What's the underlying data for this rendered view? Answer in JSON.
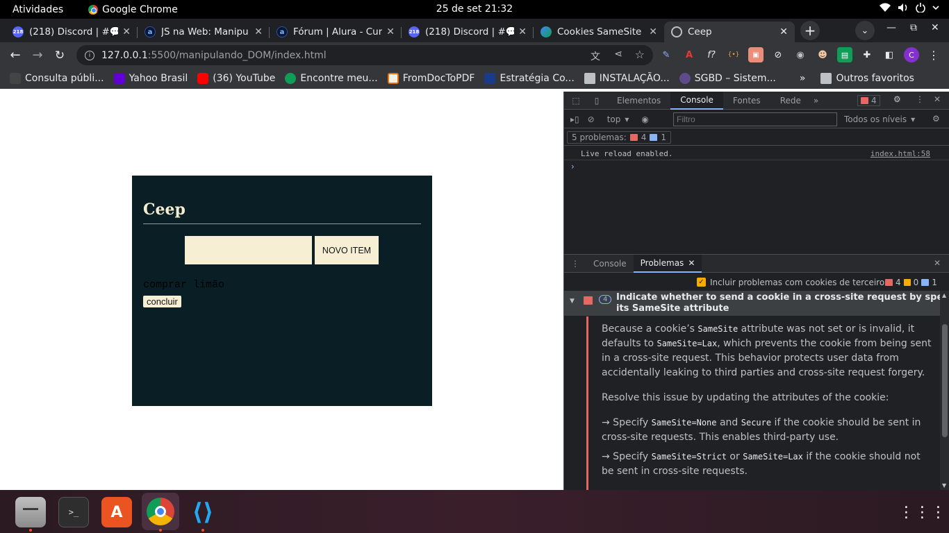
{
  "system": {
    "activities": "Atividades",
    "app_name": "Google Chrome",
    "clock": "25 de set  21:32"
  },
  "tabs": [
    {
      "title": "(218) Discord | #💬",
      "favicon": "discord-icon"
    },
    {
      "title": "JS na Web: Manipu",
      "favicon": "alura-icon"
    },
    {
      "title": "Fórum | Alura - Cur",
      "favicon": "alura-icon"
    },
    {
      "title": "(218) Discord | #💬",
      "favicon": "discord-icon"
    },
    {
      "title": "Cookies SameSite",
      "favicon": "cookie-icon"
    },
    {
      "title": "Ceep",
      "favicon": "globe-icon",
      "active": true
    }
  ],
  "discord_badge": "218",
  "address": {
    "host": "127.0.0.1",
    "path": ":5500/manipulando_DOM/index.html"
  },
  "bookmarks": [
    "Consulta públi...",
    "Yahoo Brasil",
    "(36) YouTube",
    "Encontre meu...",
    "FromDocToPDF",
    "Estratégia Co...",
    "INSTALAÇÃO...",
    "SGBD – Sistem...",
    "Outros favoritos"
  ],
  "profile_initial": "C",
  "ceep": {
    "title": "Ceep",
    "input_value": "",
    "new_item_button": "NOVO ITEM",
    "item_text": "comprar limão",
    "complete_button": "concluir"
  },
  "devtools": {
    "tabs": [
      "Elementos",
      "Console",
      "Fontes",
      "Rede"
    ],
    "active_tab": "Console",
    "error_count": "4",
    "context": "top",
    "filter_placeholder": "Filtro",
    "levels": "Todos os níveis",
    "problems_summary": "5 problemas:",
    "problems_errors": "4",
    "problems_info": "1",
    "log_message": "Live reload enabled.",
    "log_source": "index.html:58",
    "drawer_tabs": [
      "Console",
      "Problemas"
    ],
    "third_party_label": "Incluir problemas com cookies de terceiros",
    "count_errors": "4",
    "count_warnings": "0",
    "count_info": "1",
    "issue": {
      "count": "4",
      "title_line1": "Indicate whether to send a cookie in a cross-site request by specifying",
      "title_line2": "its SameSite attribute",
      "p1_a": "Because a cookie’s ",
      "p1_code1": "SameSite",
      "p1_b": " attribute was not set or is invalid, it defaults to",
      "p1_code2": "SameSite=Lax",
      "p1_c": ", which prevents the cookie from being sent in a cross-site request. This behavior protects user data from accidentally leaking to third parties and cross-site request forgery.",
      "p2": "Resolve this issue by updating the attributes of the cookie:",
      "p3_a": "→  Specify ",
      "p3_code1": "SameSite=None",
      "p3_b": " and ",
      "p3_code2": "Secure",
      "p3_c": " if the cookie should be sent in cross-site requests. This enables third-party use.",
      "p4_a": "→  Specify ",
      "p4_code1": "SameSite=Strict",
      "p4_b": " or ",
      "p4_code2": "SameSite=Lax",
      "p4_c": " if the cookie should not be sent in cross-site requests."
    }
  },
  "colors": {
    "ceep_bg": "#0a1f25",
    "ceep_accent": "#f6efd3",
    "chrome_dark": "#35363a",
    "error_red": "#e46962"
  }
}
